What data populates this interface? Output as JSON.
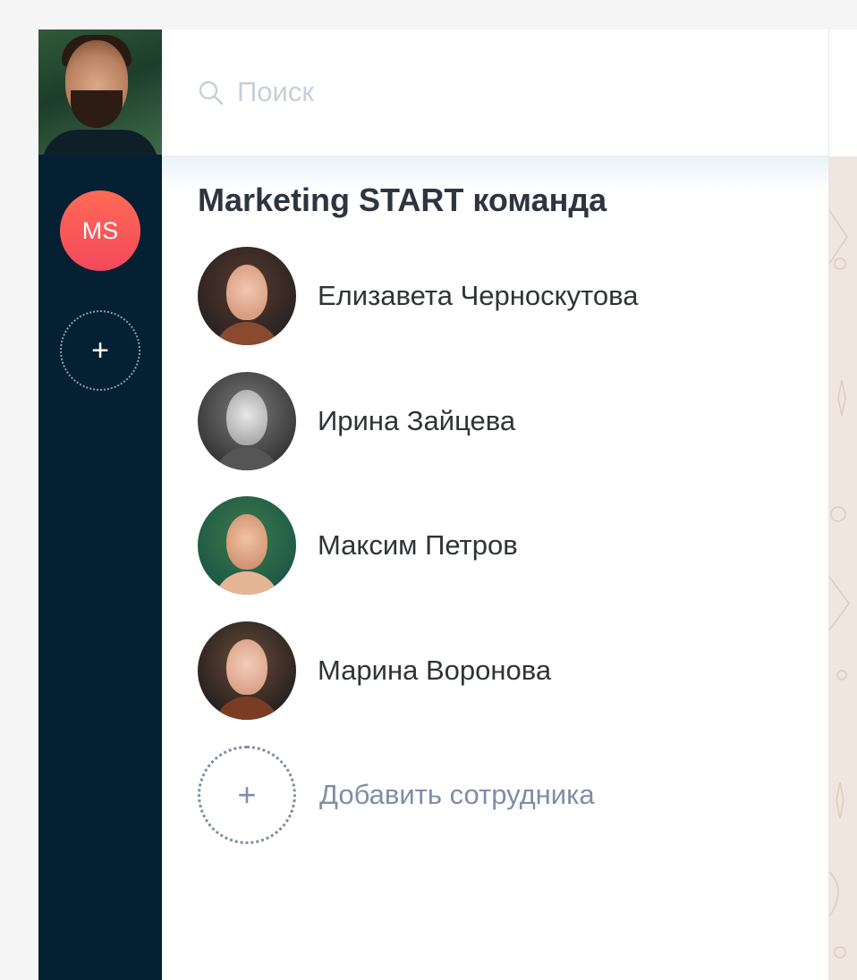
{
  "search": {
    "placeholder": "Поиск",
    "icon": "search-icon"
  },
  "sidebar": {
    "profile_avatar": "avatar",
    "team_badge": "MS",
    "add_icon": "+",
    "colors": {
      "background": "#042032",
      "badge": "#f4485c"
    }
  },
  "team": {
    "title": "Marketing START команда",
    "members": [
      {
        "name": "Елизавета Черноскутова"
      },
      {
        "name": "Ирина Зайцева"
      },
      {
        "name": "Максим Петров"
      },
      {
        "name": "Марина Воронова"
      }
    ],
    "add_member_icon": "+",
    "add_member_label": "Добавить сотрудника"
  }
}
